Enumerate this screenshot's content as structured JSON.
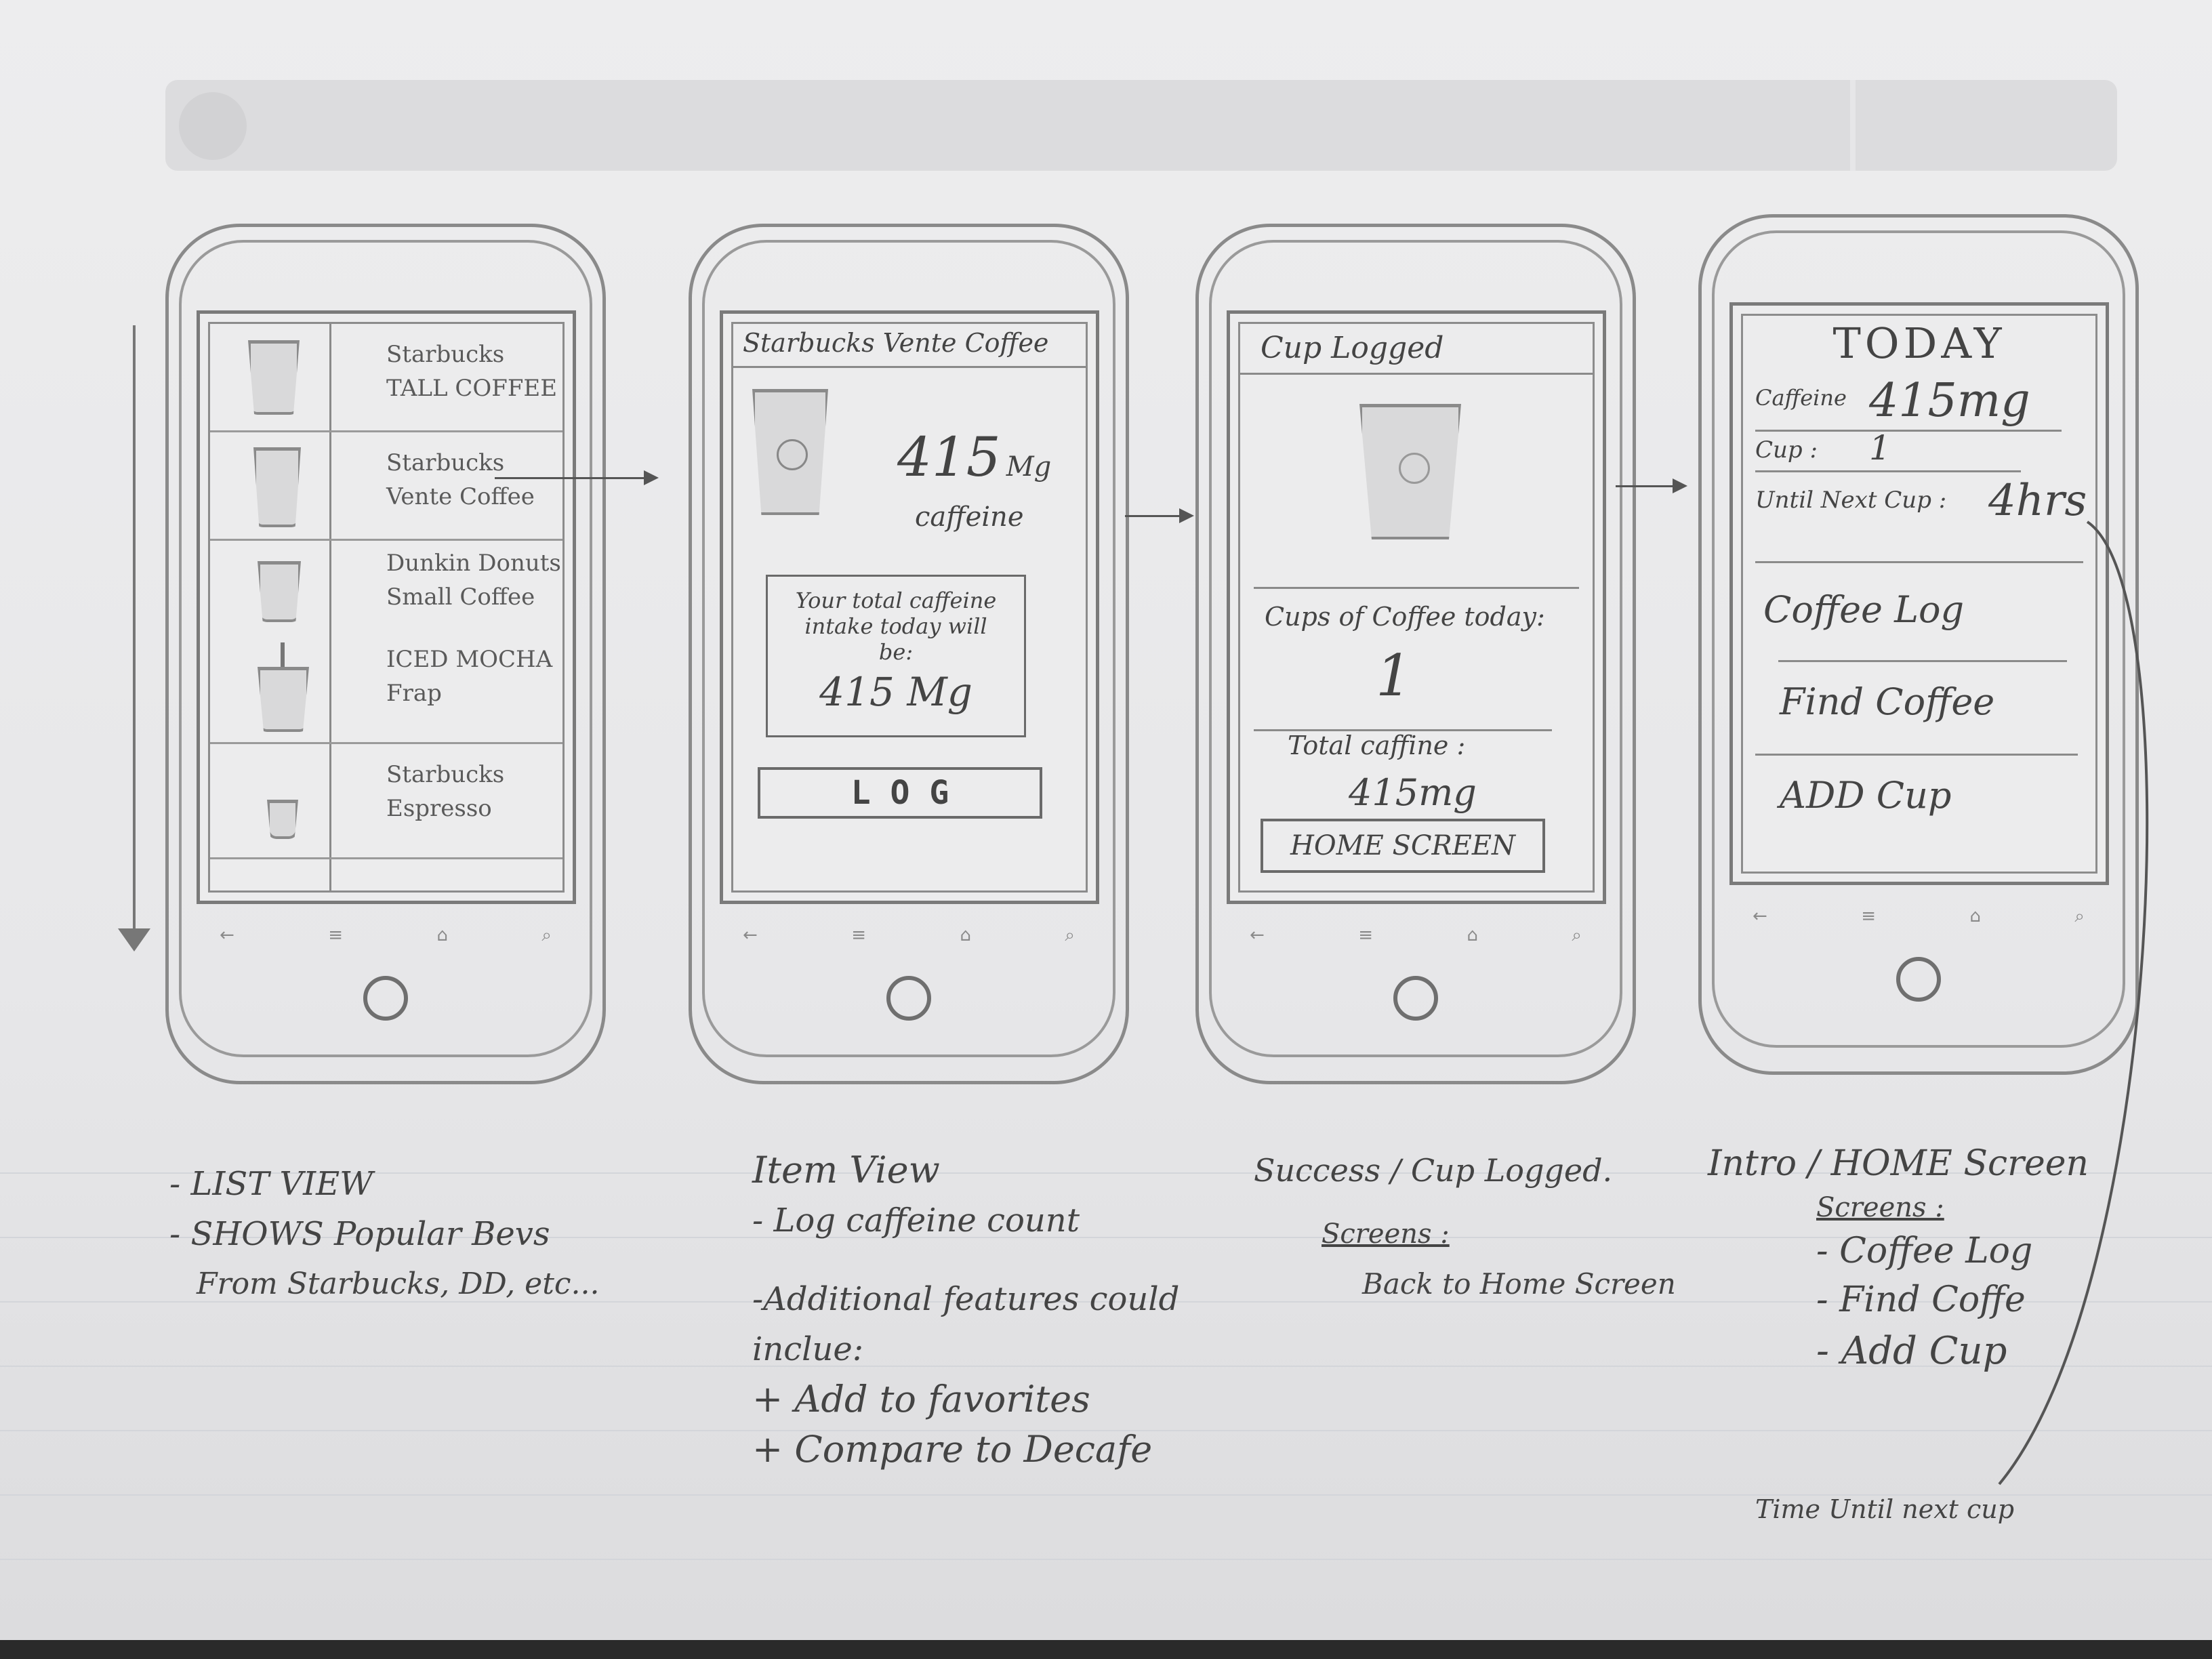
{
  "header_bar": {
    "left_label": "",
    "right_label": ""
  },
  "softkeys": [
    "←",
    "≡",
    "⌂",
    "⌕"
  ],
  "screen1": {
    "items": [
      {
        "line1": "Starbucks",
        "line2": "TALL COFFEE"
      },
      {
        "line1": "Starbucks",
        "line2": "Vente Coffee"
      },
      {
        "line1": "Dunkin Donuts",
        "line2": "Small Coffee"
      },
      {
        "line1": "ICED MOCHA",
        "line2": "Frap"
      },
      {
        "line1": "Starbucks",
        "line2": "Espresso"
      }
    ]
  },
  "screen2": {
    "title": "Starbucks Vente Coffee",
    "amount": "415",
    "unit": "Mg",
    "caffeine_label": "caffeine",
    "total_text_1": "Your total caffeine",
    "total_text_2": "intake today will",
    "total_text_3": "be:",
    "total_value": "415 Mg",
    "log_button": "L O G"
  },
  "screen3": {
    "title": "Cup Logged",
    "cups_label": "Cups of Coffee today:",
    "cups_value": "1",
    "total_label": "Total caffine :",
    "total_value": "415mg",
    "home_button": "HOME SCREEN"
  },
  "screen4": {
    "title": "TODAY",
    "caffeine_label": "Caffeine",
    "caffeine_value": "415mg",
    "cup_label": "Cup :",
    "cup_value": "1",
    "next_cup_label": "Until Next Cup :",
    "next_cup_value": "4hrs",
    "menu": [
      "Coffee Log",
      "Find Coffee",
      "ADD Cup"
    ]
  },
  "notes": {
    "n1": [
      "- LIST VIEW",
      "- SHOWS Popular Bevs",
      "From Starbucks, DD, etc..."
    ],
    "n2": {
      "title": "Item View",
      "line1": "- Log caffeine count",
      "extra": [
        "-Additional features could",
        "inclue:",
        "+ Add to favorites",
        "+ Compare to Decafe"
      ]
    },
    "n3": {
      "title": "Success / Cup Logged.",
      "screens": "Screens :",
      "item": "Back to Home Screen"
    },
    "n4": {
      "title": "Intro / HOME Screen",
      "screens": "Screens :",
      "items": [
        "- Coffee Log",
        "- Find Coffe",
        "- Add Cup"
      ],
      "footnote": "Time Until next cup"
    }
  }
}
